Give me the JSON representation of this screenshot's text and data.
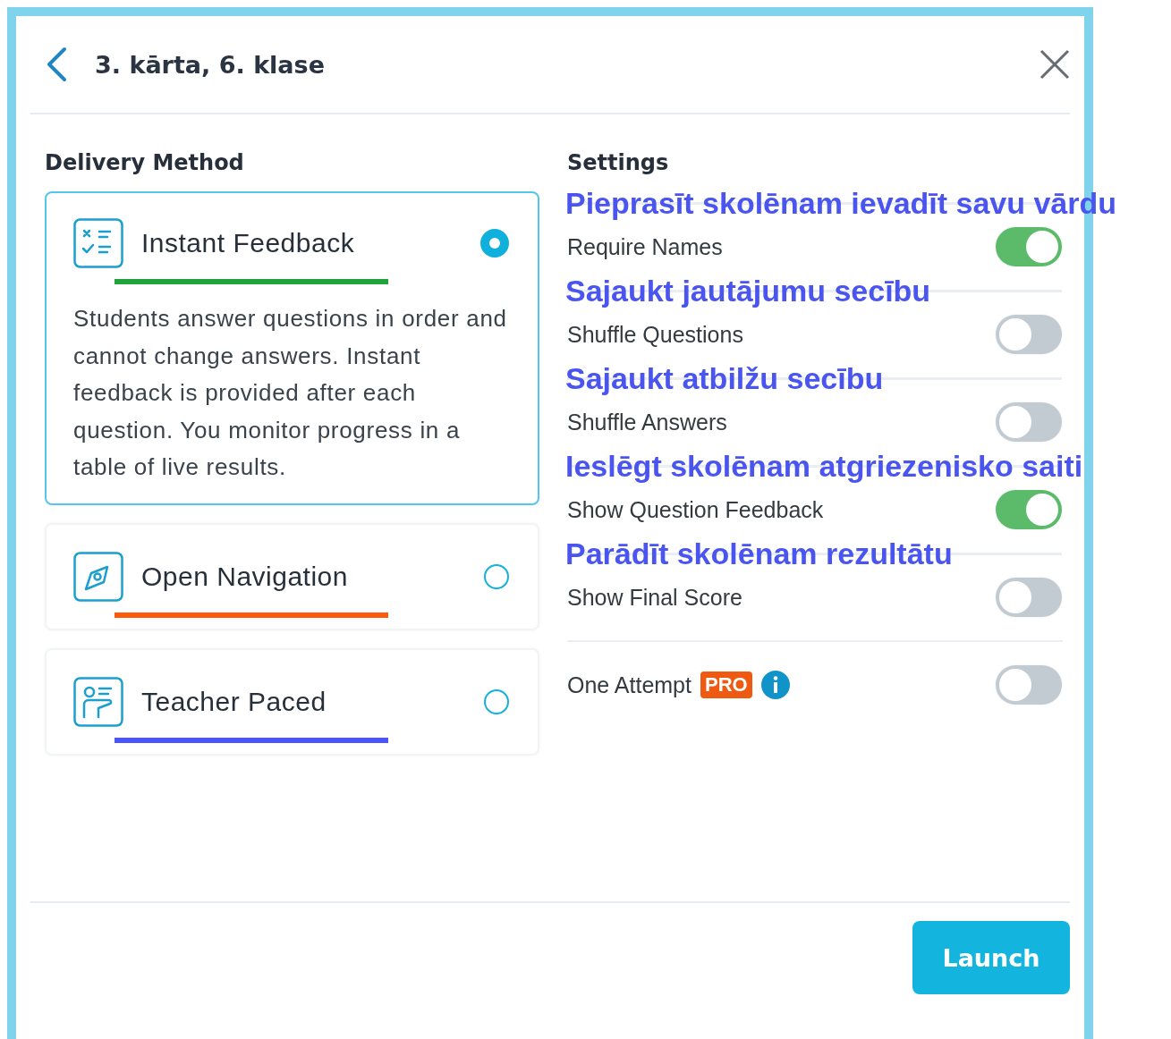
{
  "header": {
    "title": "3. kārta, 6. klase"
  },
  "delivery": {
    "heading": "Delivery Method",
    "methods": [
      {
        "kind": "feedback",
        "title": "Instant Feedback",
        "selected": true,
        "color": "#1fa33a",
        "description": "Students answer questions in order and cannot change answers. Instant feedback is provided after each question. You monitor progress in a table of live results."
      },
      {
        "kind": "navigation",
        "title": "Open Navigation",
        "selected": false,
        "color": "#ff5a0a"
      },
      {
        "kind": "teacher",
        "title": "Teacher Paced",
        "selected": false,
        "color": "#4a55ff"
      }
    ]
  },
  "settings": {
    "heading": "Settings",
    "items": [
      {
        "annotation": "Pieprasīt skolēnam ievadīt savu vārdu",
        "label": "Require Names",
        "on": true
      },
      {
        "annotation": "Sajaukt jautājumu secību",
        "label": "Shuffle Questions",
        "on": false
      },
      {
        "annotation": "Sajaukt atbilžu secību",
        "label": "Shuffle Answers",
        "on": false
      },
      {
        "annotation": "Ieslēgt skolēnam atgriezenisko saiti",
        "label": "Show Question Feedback",
        "on": true
      },
      {
        "annotation": "Parādīt skolēnam rezultātu",
        "label": "Show Final Score",
        "on": false
      },
      {
        "label": "One Attempt",
        "badge": "PRO",
        "info": true,
        "on": false
      }
    ]
  },
  "footer": {
    "button": "Launch"
  }
}
